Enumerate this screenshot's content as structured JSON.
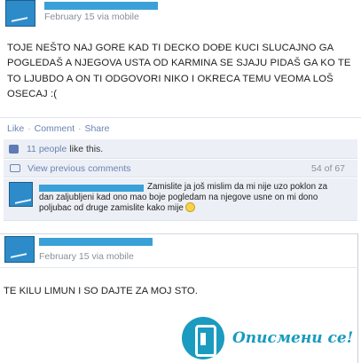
{
  "post1": {
    "author_name": "[name hidden]",
    "meta": "February 15 via mobile",
    "text": "TOJE NEŠTO NAJ GORE KAD TI DECKO DOĐE KUCI SLUCAJNO GA POGLEDAŠ A NJEGOVA USTA OD KARMINA SE SJAJU PIDAŠ GA KO TE TO LJUBDO A ON TI ODGOVORI NIKO I OKRECA TEMU VEOMA LOŠ OSECAJ :(",
    "actions": {
      "like": "Like",
      "comment": "Comment",
      "share": "Share",
      "separator": "·"
    },
    "likes": {
      "link_text": "11 people",
      "suffix": "like this."
    },
    "comments_nav": {
      "view_previous": "View previous comments",
      "count": "54 of 67"
    },
    "comment": {
      "author_name": "[name hidden]",
      "text": "Zamislite ja još mislim da mi nije uzo poklon za dan zaljubljeni kad ono mao boje pogledam na njegove usne on mi dono poljubac od druge zamislite kako mije"
    }
  },
  "post2": {
    "author_name": "[name hidden]",
    "meta": "February 15 via mobile",
    "text": "TE KILU LIMUN I SO DAJTE ZA MOJ STO."
  },
  "watermark": {
    "text": "Описмени се!",
    "icon": "info-book-icon",
    "color": "#1a9bbf"
  },
  "colors": {
    "link": "#6b84b4",
    "ufi_background": "#eceff5",
    "redaction": "#3aa0d8"
  }
}
